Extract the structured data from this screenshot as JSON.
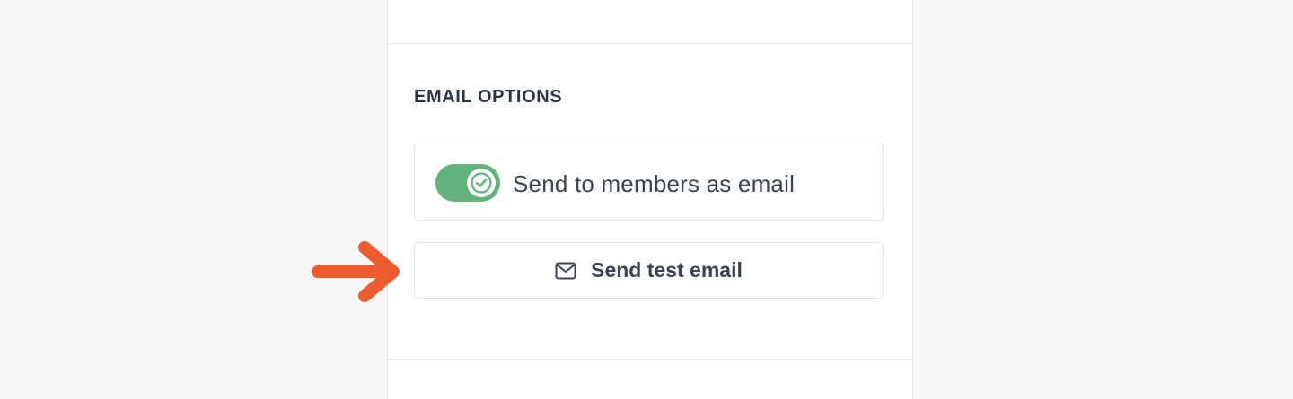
{
  "section": {
    "title": "EMAIL OPTIONS"
  },
  "toggle": {
    "label": "Send to members as email",
    "state": "on",
    "color": "#65b37c"
  },
  "test_button": {
    "label": "Send test email",
    "icon": "mail-icon"
  },
  "annotation": {
    "arrow_color": "#ee5b2e",
    "icon": "arrow-right-icon"
  }
}
